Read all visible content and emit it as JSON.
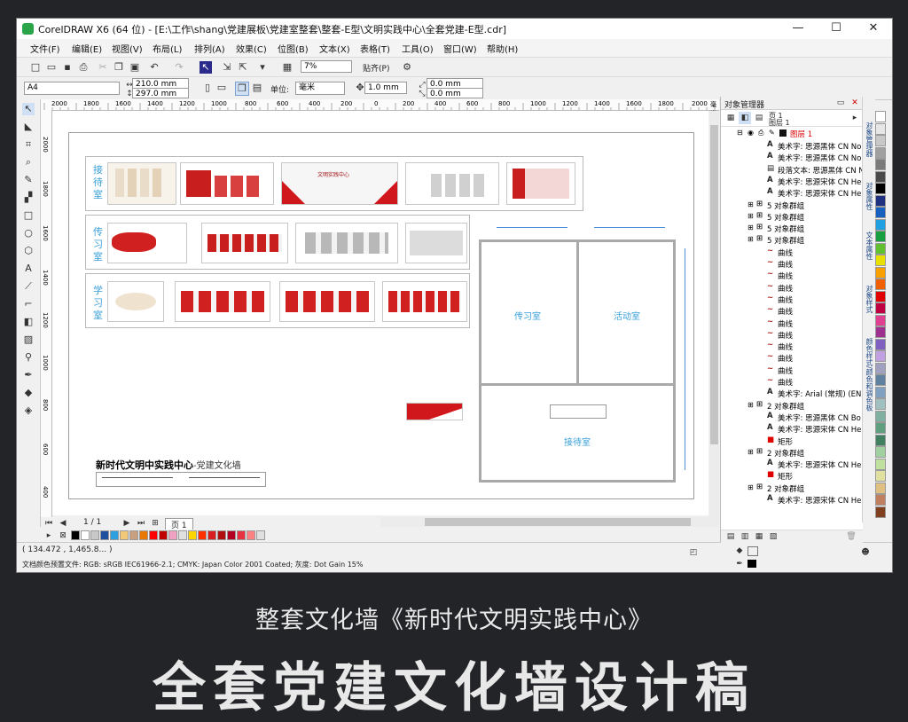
{
  "window": {
    "title": "CorelDRAW X6 (64 位) - [E:\\工作\\shang\\党建展板\\党建室整套\\整套-E型\\文明实践中心\\全套党建-E型.cdr]",
    "minimize": "—",
    "maximize": "☐",
    "close": "✕"
  },
  "menu": [
    "文件(F)",
    "编辑(E)",
    "视图(V)",
    "布局(L)",
    "排列(A)",
    "效果(C)",
    "位图(B)",
    "文本(X)",
    "表格(T)",
    "工具(O)",
    "窗口(W)",
    "帮助(H)"
  ],
  "toolbar": {
    "zoom": "7%",
    "snap": "贴齐(P)"
  },
  "property_bar": {
    "paper": "A4",
    "width": "210.0 mm",
    "height": "297.0 mm",
    "units_label": "单位:",
    "units": "毫米",
    "nudge": "1.0 mm",
    "dup_x": "0.0 mm",
    "dup_y": "0.0 mm"
  },
  "ruler_h": [
    "2000",
    "1800",
    "1600",
    "1400",
    "1200",
    "1000",
    "800",
    "600",
    "400",
    "200",
    "0",
    "200",
    "400",
    "600",
    "800",
    "1000",
    "1200",
    "1400",
    "1600",
    "1800",
    "2000",
    "毫米"
  ],
  "ruler_v": [
    "2000",
    "1800",
    "1600",
    "1400",
    "1200",
    "1000",
    "800",
    "600",
    "400"
  ],
  "design": {
    "rooms": [
      "接待室",
      "传习室",
      "学习室"
    ],
    "plan_labels": {
      "chuanxi": "传习室",
      "huodong": "活动室",
      "jiedai": "接待室"
    },
    "banner_text": "文明实践中心",
    "footer_title": "新时代文明中实践中心",
    "footer_subtitle": "-党建文化墙"
  },
  "page_nav": {
    "counter": "1 / 1",
    "tab": "页 1"
  },
  "status": {
    "coords": "( 134.472 , 1,465.8... )",
    "color_profile": "文档颜色预置文件: RGB: sRGB IEC61966-2.1; CMYK: Japan Color 2001 Coated; 灰度: Dot Gain 15%"
  },
  "docker": {
    "title": "对象管理器",
    "page": "页 1",
    "layer_root": "图层 1",
    "layer": "图层 1",
    "items": [
      {
        "icon": "A",
        "label": "美术字: 思源黑体 CN No",
        "indent": 1
      },
      {
        "icon": "A",
        "label": "美术字: 思源黑体 CN No",
        "indent": 1
      },
      {
        "icon": "▤",
        "label": "段落文本: 思源黑体 CN N",
        "indent": 1
      },
      {
        "icon": "A",
        "label": "美术字: 思源宋体 CN He",
        "indent": 1
      },
      {
        "icon": "A",
        "label": "美术字: 思源宋体 CN He",
        "indent": 1
      },
      {
        "icon": "⊞",
        "label": "5 对象群组",
        "indent": 0
      },
      {
        "icon": "⊞",
        "label": "5 对象群组",
        "indent": 0
      },
      {
        "icon": "⊞",
        "label": "5 对象群组",
        "indent": 0
      },
      {
        "icon": "⊞",
        "label": "5 对象群组",
        "indent": 0
      },
      {
        "icon": "~",
        "label": "曲线",
        "indent": 1
      },
      {
        "icon": "~",
        "label": "曲线",
        "indent": 1
      },
      {
        "icon": "~",
        "label": "曲线",
        "indent": 1
      },
      {
        "icon": "~",
        "label": "曲线",
        "indent": 1
      },
      {
        "icon": "~",
        "label": "曲线",
        "indent": 1
      },
      {
        "icon": "~",
        "label": "曲线",
        "indent": 1
      },
      {
        "icon": "~",
        "label": "曲线",
        "indent": 1
      },
      {
        "icon": "~",
        "label": "曲线",
        "indent": 1
      },
      {
        "icon": "~",
        "label": "曲线",
        "indent": 1
      },
      {
        "icon": "~",
        "label": "曲线",
        "indent": 1
      },
      {
        "icon": "~",
        "label": "曲线",
        "indent": 1
      },
      {
        "icon": "~",
        "label": "曲线",
        "indent": 1
      },
      {
        "icon": "A",
        "label": "美术字: Arial (常规) (ENU",
        "indent": 1
      },
      {
        "icon": "⊞",
        "label": "2 对象群组",
        "indent": 0
      },
      {
        "icon": "A",
        "label": "美术字: 思源黑体 CN Bo",
        "indent": 1
      },
      {
        "icon": "A",
        "label": "美术字: 思源宋体 CN He",
        "indent": 1
      },
      {
        "icon": "■",
        "label": "矩形",
        "indent": 1
      },
      {
        "icon": "⊞",
        "label": "2 对象群组",
        "indent": 0
      },
      {
        "icon": "A",
        "label": "美术字: 思源宋体 CN He",
        "indent": 1
      },
      {
        "icon": "■",
        "label": "矩形",
        "indent": 1
      },
      {
        "icon": "⊞",
        "label": "2 对象群组",
        "indent": 0
      },
      {
        "icon": "A",
        "label": "美术字: 思源宋体 CN He",
        "indent": 1
      }
    ]
  },
  "side_tabs": [
    "对象管理器",
    "对象属性",
    "文本属性",
    "对象样式",
    "颜色样式/颜色和调色板"
  ],
  "palette": [
    "#000000",
    "#ffffff",
    "#c8c8c8",
    "#1e50a0",
    "#2ea0e0",
    "#f0c878",
    "#c8a080",
    "#e87800",
    "#ff0000",
    "#c00000",
    "#f0a0c0",
    "#e0e0e0",
    "#ffd700",
    "#ff3000",
    "#d81e1e",
    "#b01010",
    "#b40020",
    "#e83040",
    "#ff8080",
    "#e0e0e0"
  ],
  "right_palette": [
    "#ffffff",
    "#e6e6e6",
    "#c8c8c8",
    "#a0a0a0",
    "#7a7a7a",
    "#4a4a4a",
    "#000000",
    "#203080",
    "#1860c0",
    "#20a0e0",
    "#18a040",
    "#60c030",
    "#e8e000",
    "#f8a000",
    "#f06000",
    "#e00000",
    "#c00040",
    "#e04090",
    "#a03090",
    "#8060c0",
    "#c0a0e0",
    "#a0a0c0",
    "#6080a0",
    "#80a0c0",
    "#a0c0c0",
    "#80b0a0",
    "#60a080",
    "#408060",
    "#a0d0a0",
    "#c0e0a0",
    "#e0e0a0",
    "#e0c080",
    "#c08060",
    "#804020"
  ],
  "caption": {
    "line1": "整套文化墙《新时代文明实践中心》",
    "line2": "全套党建文化墙设计稿"
  }
}
